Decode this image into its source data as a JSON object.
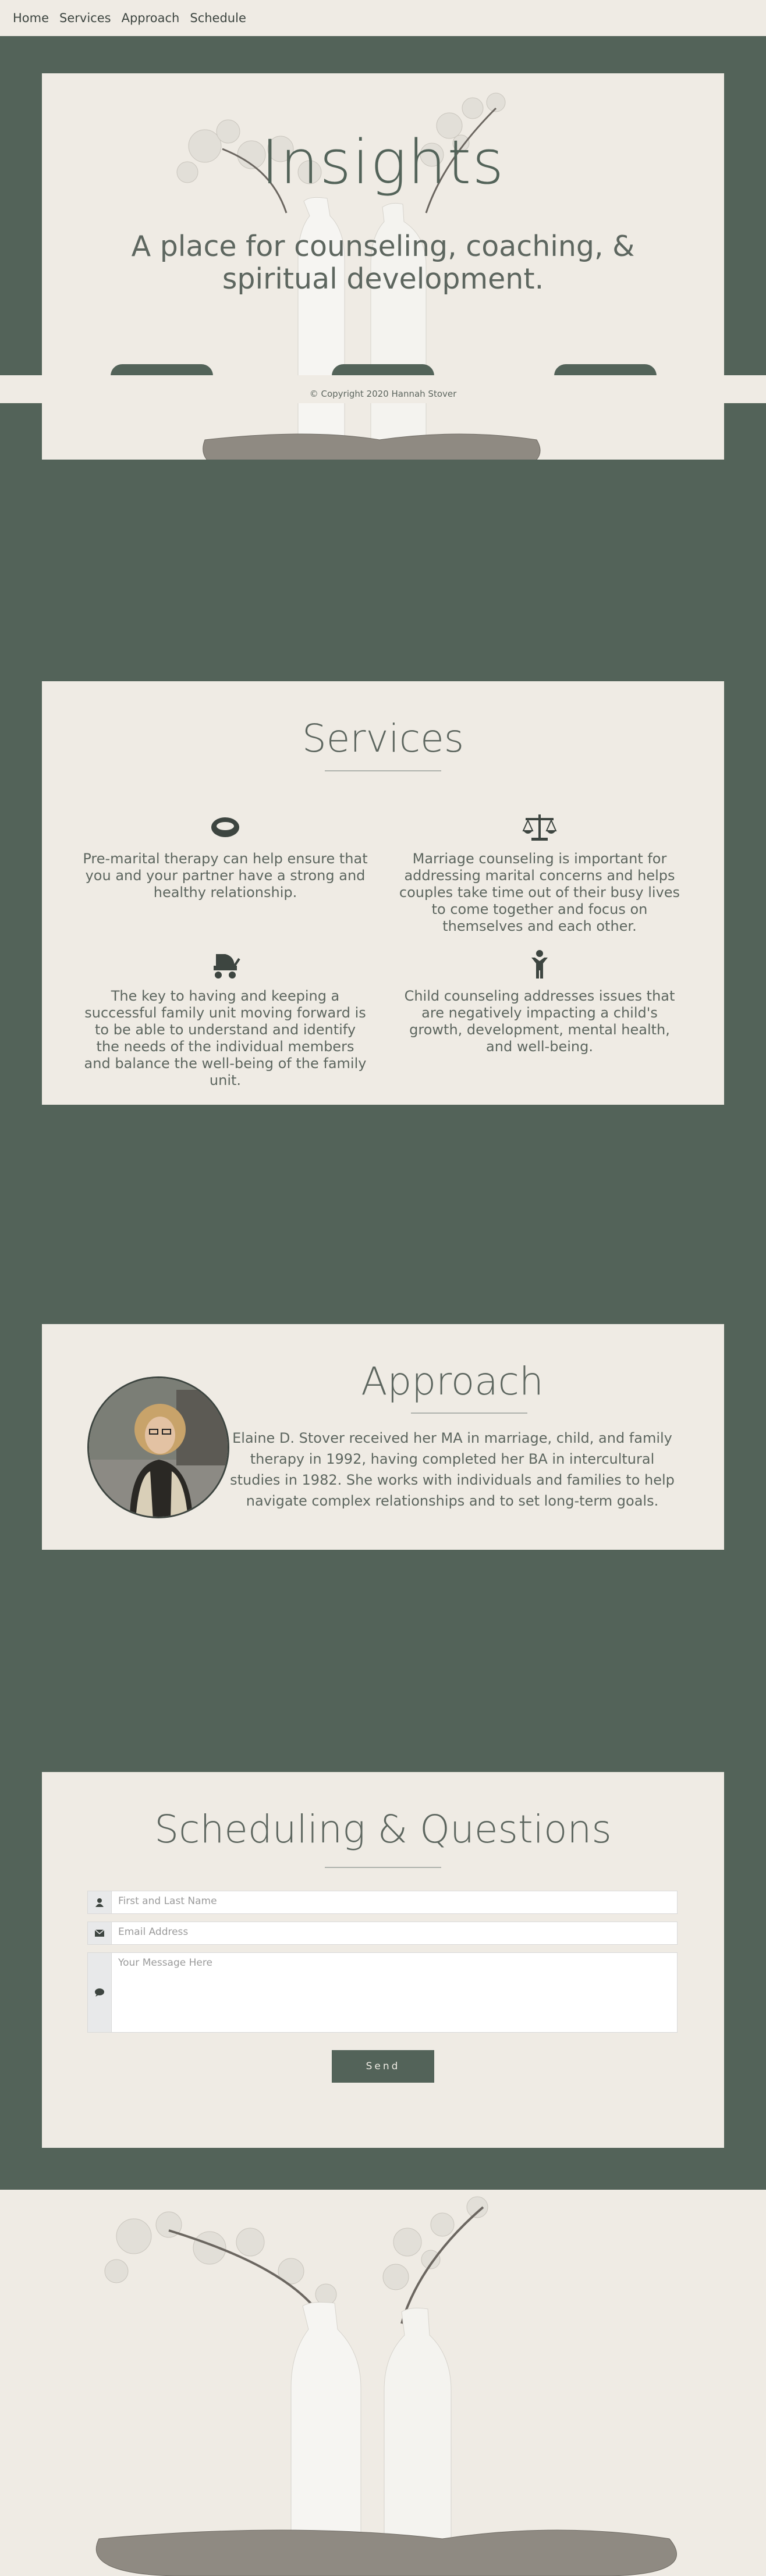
{
  "nav": {
    "items": [
      {
        "label": "Home"
      },
      {
        "label": "Services"
      },
      {
        "label": "Approach"
      },
      {
        "label": "Schedule"
      }
    ]
  },
  "hero": {
    "title": "Insights",
    "subtitle": "A place for counseling, coaching, & spiritual development."
  },
  "footer": {
    "copyright": "© Copyright 2020 Hannah Stover"
  },
  "services": {
    "title": "Services",
    "items": [
      {
        "icon": "ring-icon",
        "text": "Pre-marital therapy can help ensure that you and your partner have a strong and healthy relationship."
      },
      {
        "icon": "balance-scale-icon",
        "text": "Marriage counseling is important for addressing marital concerns and helps couples take time out of their busy lives to come together and focus on themselves and each other."
      },
      {
        "icon": "baby-carriage-icon",
        "text": "The key to having and keeping a successful family unit moving forward is to be able to understand and identify the needs of the individual members and balance the well-being of the family unit."
      },
      {
        "icon": "child-icon",
        "text": "Child counseling addresses issues that are negatively impacting a child's growth, development, mental health, and well-being."
      }
    ]
  },
  "approach": {
    "title": "Approach",
    "text": "Elaine D. Stover received her MA in marriage, child, and family therapy in 1992, having completed her BA in intercultural studies in 1982. She works with individuals and families to help navigate complex relationships and to set long-term goals."
  },
  "schedule": {
    "title": "Scheduling & Questions",
    "name_placeholder": "First and Last Name",
    "email_placeholder": "Email Address",
    "message_placeholder": "Your Message Here",
    "send_label": "Send"
  },
  "colors": {
    "primary": "#536359",
    "cream": "#efebe4",
    "text": "#5d665f"
  }
}
